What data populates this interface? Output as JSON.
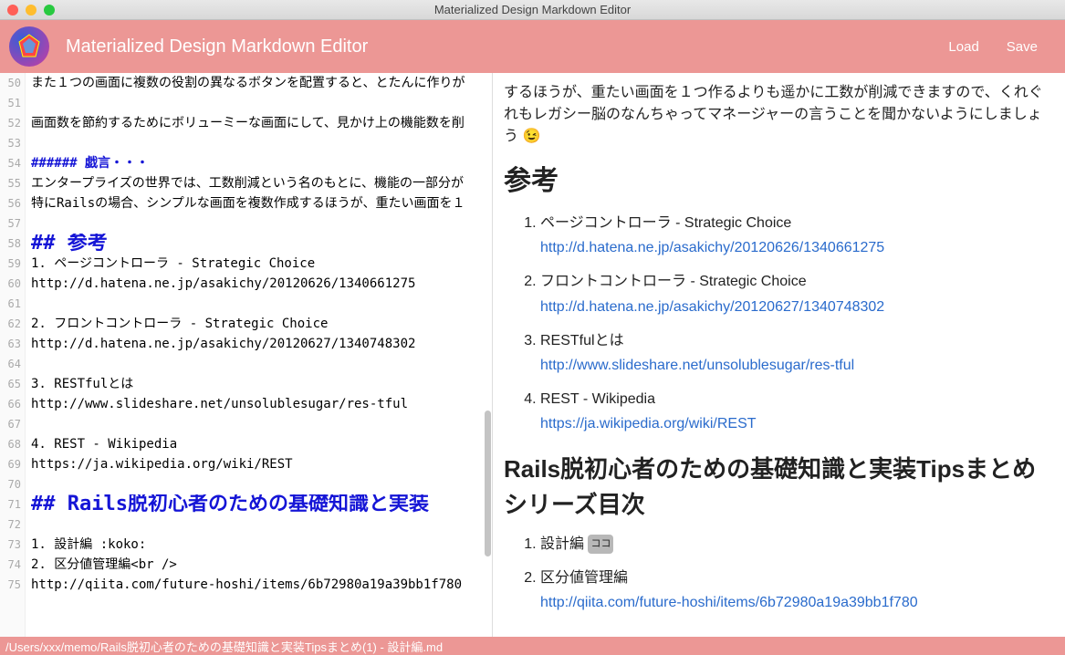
{
  "window": {
    "title": "Materialized Design Markdown Editor"
  },
  "appbar": {
    "title": "Materialized Design Markdown Editor",
    "load": "Load",
    "save": "Save"
  },
  "editor": {
    "start_line": 50,
    "lines": [
      {
        "n": 50,
        "t": "また１つの画面に複数の役割の異なるボタンを配置すると、とたんに作りが",
        "cls": ""
      },
      {
        "n": 51,
        "t": "",
        "cls": ""
      },
      {
        "n": 52,
        "t": "画面数を節約するためにボリューミーな画面にして、見かけ上の機能数を削",
        "cls": ""
      },
      {
        "n": 53,
        "t": "",
        "cls": ""
      },
      {
        "n": 54,
        "t": "###### 戯言・・・",
        "cls": "md-h6"
      },
      {
        "n": 55,
        "t": "エンタープライズの世界では、工数削減という名のもとに、機能の一部分が",
        "cls": ""
      },
      {
        "n": 56,
        "t": "特にRailsの場合、シンプルな画面を複数作成するほうが、重たい画面を１",
        "cls": ""
      },
      {
        "n": 57,
        "t": "",
        "cls": ""
      },
      {
        "n": 58,
        "t": "## 参考",
        "cls": "md-h2"
      },
      {
        "n": 59,
        "t": "1. ページコントローラ - Strategic Choice",
        "cls": ""
      },
      {
        "n": 60,
        "t": "http://d.hatena.ne.jp/asakichy/20120626/1340661275",
        "cls": ""
      },
      {
        "n": 61,
        "t": "",
        "cls": ""
      },
      {
        "n": 62,
        "t": "2. フロントコントローラ - Strategic Choice",
        "cls": ""
      },
      {
        "n": 63,
        "t": "http://d.hatena.ne.jp/asakichy/20120627/1340748302",
        "cls": ""
      },
      {
        "n": 64,
        "t": "",
        "cls": ""
      },
      {
        "n": 65,
        "t": "3. RESTfulとは",
        "cls": ""
      },
      {
        "n": 66,
        "t": "http://www.slideshare.net/unsolublesugar/res-tful",
        "cls": ""
      },
      {
        "n": 67,
        "t": "",
        "cls": ""
      },
      {
        "n": 68,
        "t": "4. REST - Wikipedia",
        "cls": ""
      },
      {
        "n": 69,
        "t": "https://ja.wikipedia.org/wiki/REST",
        "cls": ""
      },
      {
        "n": 70,
        "t": "",
        "cls": ""
      },
      {
        "n": 71,
        "t": "## Rails脱初心者のための基礎知識と実装",
        "cls": "md-h2"
      },
      {
        "n": 72,
        "t": "",
        "cls": ""
      },
      {
        "n": 73,
        "t": "1. 設計編 :koko:",
        "cls": ""
      },
      {
        "n": 74,
        "t": "2. 区分値管理編<br />",
        "cls": ""
      },
      {
        "n": 75,
        "t": "http://qiita.com/future-hoshi/items/6b72980a19a39bb1f780",
        "cls": ""
      }
    ]
  },
  "preview": {
    "intro1": "するほうが、重たい画面を１つ作るよりも遥かに工数が削減できますので、くれぐれもレガシー脳のなんちゃってマネージャーの言うことを聞かないようにしましょう 😉",
    "h_sankou": "参考",
    "refs": [
      {
        "title": "ページコントローラ - Strategic Choice",
        "url": "http://d.hatena.ne.jp/asakichy/20120626/1340661275"
      },
      {
        "title": "フロントコントローラ - Strategic Choice",
        "url": "http://d.hatena.ne.jp/asakichy/20120627/1340748302"
      },
      {
        "title": "RESTfulとは",
        "url": "http://www.slideshare.net/unsolublesugar/res-tful"
      },
      {
        "title": "REST - Wikipedia",
        "url": "https://ja.wikipedia.org/wiki/REST"
      }
    ],
    "h_series": "Rails脱初心者のための基礎知識と実装Tipsまとめシリーズ目次",
    "series": [
      {
        "title": "設計編",
        "badge": "ココ"
      },
      {
        "title": "区分値管理編",
        "url": "http://qiita.com/future-hoshi/items/6b72980a19a39bb1f780"
      }
    ]
  },
  "statusbar": {
    "path": "/Users/xxx/memo/Rails脱初心者のための基礎知識と実装Tipsまとめ(1) - 設計編.md"
  }
}
